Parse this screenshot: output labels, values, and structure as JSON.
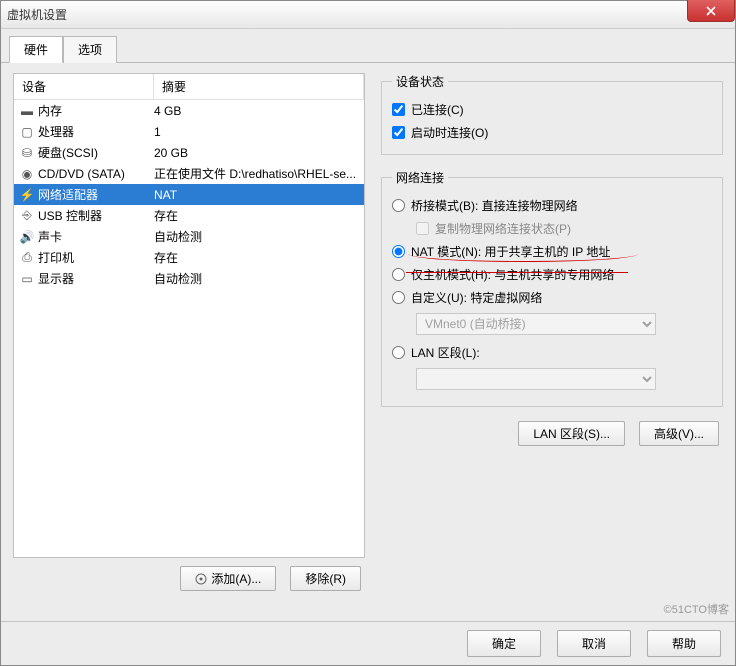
{
  "window": {
    "title": "虚拟机设置"
  },
  "tabs": {
    "hardware": "硬件",
    "options": "选项"
  },
  "list": {
    "header_device": "设备",
    "header_summary": "摘要",
    "rows": [
      {
        "name": "内存",
        "summary": "4 GB",
        "icon": "memory"
      },
      {
        "name": "处理器",
        "summary": "1",
        "icon": "cpu"
      },
      {
        "name": "硬盘(SCSI)",
        "summary": "20 GB",
        "icon": "disk"
      },
      {
        "name": "CD/DVD (SATA)",
        "summary": "正在使用文件 D:\\redhatiso\\RHEL-se...",
        "icon": "cd"
      },
      {
        "name": "网络适配器",
        "summary": "NAT",
        "icon": "net"
      },
      {
        "name": "USB 控制器",
        "summary": "存在",
        "icon": "usb"
      },
      {
        "name": "声卡",
        "summary": "自动检测",
        "icon": "sound"
      },
      {
        "name": "打印机",
        "summary": "存在",
        "icon": "printer"
      },
      {
        "name": "显示器",
        "summary": "自动检测",
        "icon": "display"
      }
    ]
  },
  "left_buttons": {
    "add": "添加(A)...",
    "remove": "移除(R)"
  },
  "status": {
    "legend": "设备状态",
    "connected": "已连接(C)",
    "connect_on_start": "启动时连接(O)"
  },
  "network": {
    "legend": "网络连接",
    "bridged": "桥接模式(B): 直接连接物理网络",
    "replicate": "复制物理网络连接状态(P)",
    "nat": "NAT 模式(N): 用于共享主机的 IP 地址",
    "hostonly": "仅主机模式(H): 与主机共享的专用网络",
    "custom": "自定义(U): 特定虚拟网络",
    "vmnet_placeholder": "VMnet0 (自动桥接)",
    "lan": "LAN 区段(L):"
  },
  "right_buttons": {
    "lan": "LAN 区段(S)...",
    "advanced": "高级(V)..."
  },
  "bottom": {
    "ok": "确定",
    "cancel": "取消",
    "help": "帮助"
  },
  "watermark": "©51CTO博客"
}
